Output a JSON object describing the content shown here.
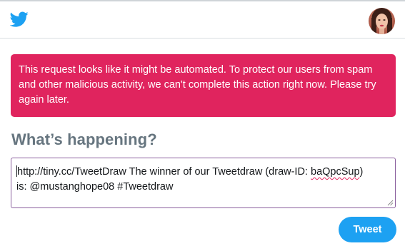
{
  "header": {
    "logo_icon": "twitter-bird-icon",
    "avatar_icon": "user-avatar",
    "brand_color": "#1da1f2"
  },
  "alert": {
    "text": "This request looks like it might be automated. To protect our users from spam and other malicious activity, we can't complete this action right now. Please try again later.",
    "color": "#e0245e"
  },
  "composer": {
    "heading": "What’s happening?",
    "text_before": "http://tiny.cc/TweetDraw The winner of our Tweetdraw (draw-ID: ",
    "text_misspelled": "baQpcSup",
    "text_after": ")\nis: @mustanghope08 #Tweetdraw",
    "tweet_label": "Tweet"
  }
}
